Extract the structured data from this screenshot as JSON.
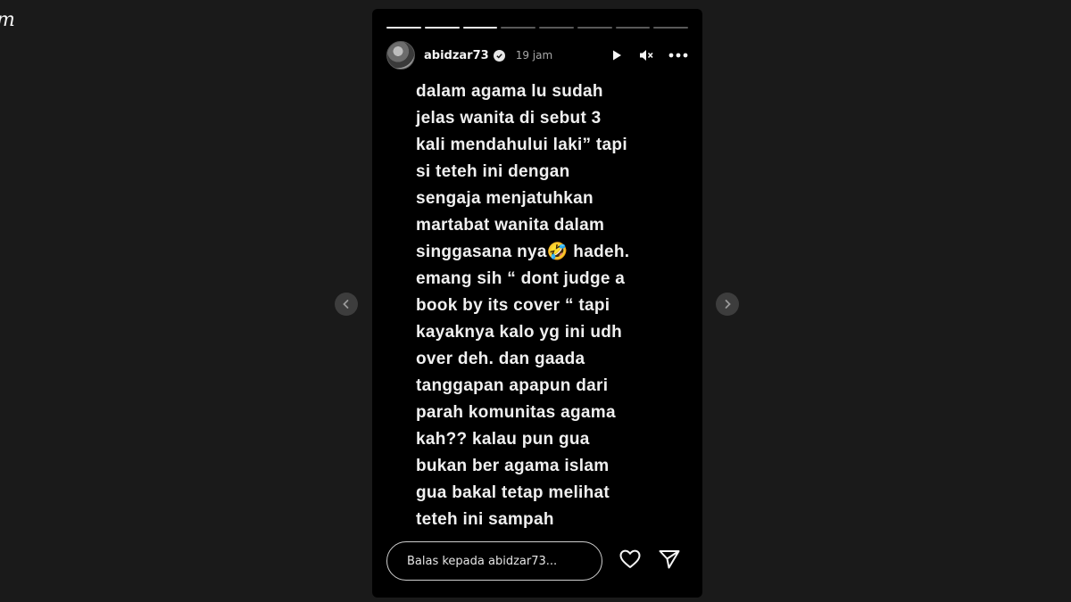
{
  "brand": {
    "fragment": "m"
  },
  "story": {
    "progress_segments": [
      {
        "done": true
      },
      {
        "done": true
      },
      {
        "done": true
      },
      {
        "done": false
      },
      {
        "done": false
      },
      {
        "done": false
      },
      {
        "done": false
      },
      {
        "done": false
      }
    ],
    "header": {
      "username": "abidzar73",
      "verified": true,
      "time": "19 jam",
      "icons": [
        "play-icon",
        "mute-icon",
        "more-icon"
      ]
    },
    "text_lines": [
      "dalam agama lu sudah",
      "jelas wanita di sebut 3",
      "kali mendahului laki” tapi",
      "si teteh ini dengan",
      "sengaja menjatuhkan",
      "martabat wanita dalam",
      "singgasana nya🤣 hadeh.",
      "emang sih “ dont judge a",
      "book by its cover “ tapi",
      "kayaknya kalo yg ini udh",
      "over deh. dan gaada",
      "tanggapan apapun dari",
      "parah komunitas agama",
      "kah?? kalau pun gua",
      "bukan ber agama islam",
      "gua bakal tetap melihat",
      "teteh ini sampah"
    ],
    "footer": {
      "reply_placeholder": "Balas kepada abidzar73...",
      "icons": [
        "heart-icon",
        "send-icon"
      ]
    }
  },
  "nav": {
    "prev_icon": "chevron-left-icon",
    "next_icon": "chevron-right-icon"
  },
  "colors": {
    "page_bg": "#1a1a1a",
    "story_bg": "#000000",
    "text": "#f0f0f0",
    "muted": "#a8a8a8"
  }
}
